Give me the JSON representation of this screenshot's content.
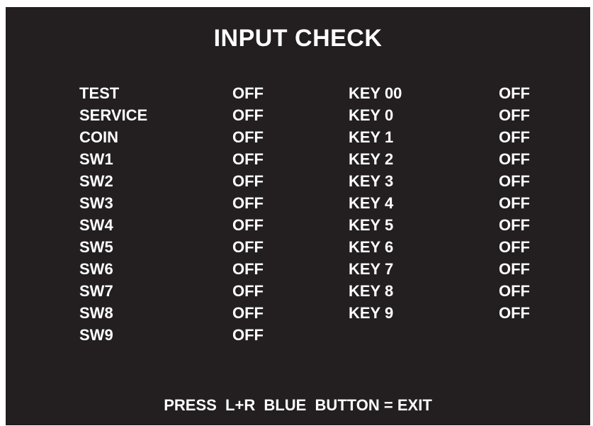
{
  "screen": {
    "title": "INPUT CHECK",
    "footer": "PRESS  L+R  BLUE  BUTTON = EXIT",
    "colors": {
      "background": "#231f20",
      "text": "#ffffff"
    }
  },
  "left_inputs": [
    {
      "name": "TEST",
      "state": "OFF"
    },
    {
      "name": "SERVICE",
      "state": "OFF"
    },
    {
      "name": "COIN",
      "state": "OFF"
    },
    {
      "name": "SW1",
      "state": "OFF"
    },
    {
      "name": "SW2",
      "state": "OFF"
    },
    {
      "name": "SW3",
      "state": "OFF"
    },
    {
      "name": "SW4",
      "state": "OFF"
    },
    {
      "name": "SW5",
      "state": "OFF"
    },
    {
      "name": "SW6",
      "state": "OFF"
    },
    {
      "name": "SW7",
      "state": "OFF"
    },
    {
      "name": "SW8",
      "state": "OFF"
    },
    {
      "name": "SW9",
      "state": "OFF"
    }
  ],
  "right_inputs": [
    {
      "name": "KEY 00",
      "state": "OFF"
    },
    {
      "name": "KEY 0",
      "state": "OFF"
    },
    {
      "name": "KEY 1",
      "state": "OFF"
    },
    {
      "name": "KEY 2",
      "state": "OFF"
    },
    {
      "name": "KEY 3",
      "state": "OFF"
    },
    {
      "name": "KEY 4",
      "state": "OFF"
    },
    {
      "name": "KEY 5",
      "state": "OFF"
    },
    {
      "name": "KEY 6",
      "state": "OFF"
    },
    {
      "name": "KEY 7",
      "state": "OFF"
    },
    {
      "name": "KEY 8",
      "state": "OFF"
    },
    {
      "name": "KEY 9",
      "state": "OFF"
    }
  ]
}
